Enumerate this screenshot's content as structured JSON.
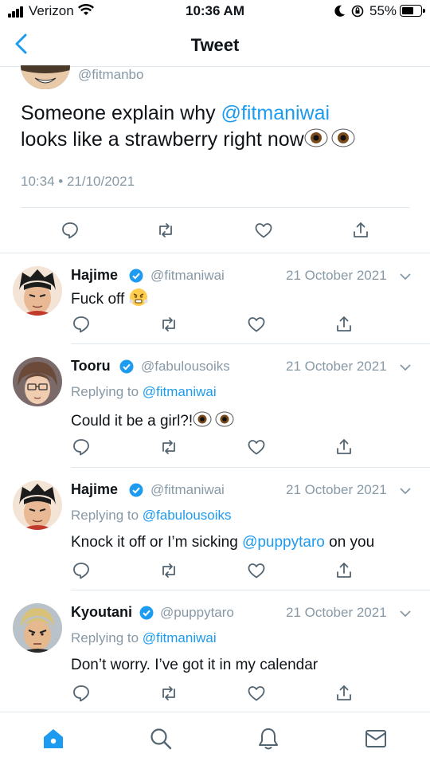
{
  "status_bar": {
    "carrier": "Verizon",
    "time": "10:36 AM",
    "battery": "55%"
  },
  "nav": {
    "title": "Tweet",
    "back_icon": "chevron-left-icon"
  },
  "main_tweet": {
    "handle": "@fitmanbo",
    "text_part1": "Someone explain why ",
    "mention": "@fitmaniwai",
    "text_part2": "looks like a strawberry right now",
    "emoji": "eyes",
    "timestamp": "10:34 • 21/10/2021",
    "actions": [
      "reply-icon",
      "retweet-icon",
      "like-icon",
      "share-icon"
    ]
  },
  "replies": [
    {
      "name": "Hajime",
      "handle": "@fitmaniwai",
      "date": "21 October 2021",
      "replying_label": "",
      "replying_to": "",
      "text": "Fuck off",
      "text_mention": "",
      "text_after": "",
      "emoji": "steam-face"
    },
    {
      "name": "Tooru",
      "handle": "@fabulousoiks",
      "date": "21 October 2021",
      "replying_label": "Replying to ",
      "replying_to": "@fitmaniwai",
      "text": "Could it be a girl?!",
      "text_mention": "",
      "text_after": "",
      "emoji": "eyes"
    },
    {
      "name": "Hajime",
      "handle": "@fitmaniwai",
      "date": "21 October 2021",
      "replying_label": "Replying to ",
      "replying_to": "@fabulousoiks",
      "text": "Knock it off or I’m sicking ",
      "text_mention": "@puppytaro",
      "text_after": " on you",
      "emoji": ""
    },
    {
      "name": "Kyoutani",
      "handle": "@puppytaro",
      "date": "21 October 2021",
      "replying_label": "Replying to ",
      "replying_to": "@fitmaniwai",
      "text": "Don’t worry. I’ve got it in my calendar",
      "text_mention": "",
      "text_after": "",
      "emoji": ""
    }
  ],
  "tab_bar": {
    "items": [
      "home-icon",
      "search-icon",
      "notifications-icon",
      "messages-icon"
    ],
    "active": "home-icon"
  },
  "colors": {
    "accent": "#1d9bf0",
    "secondary_text": "#8899a6",
    "divider": "#e1e8ed",
    "primary_text": "#0f1419"
  }
}
